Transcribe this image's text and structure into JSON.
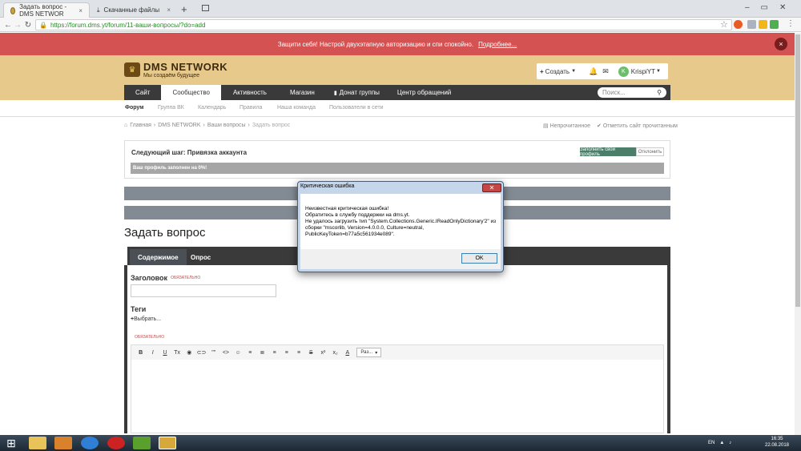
{
  "browser": {
    "tabs": [
      {
        "label": "Задать вопрос - DMS NETWOR",
        "close": "×"
      },
      {
        "label": "Скачанные файлы",
        "close": "×"
      }
    ],
    "new_tab": "+",
    "url": "https://forum.dms.yt/forum/11-ваши-вопросы/?do=add"
  },
  "notice": {
    "text": "Защити себя! Настрой двухэтапную авторизацию и спи спокойно.",
    "link": "Подробнее...",
    "close": "×"
  },
  "header": {
    "logo_title": "DMS NETWORK",
    "logo_sub": "Мы создаём будущее",
    "create_label": "Создать",
    "user_initial": "K",
    "username": "KrispiYT"
  },
  "nav": {
    "tabs": [
      "Сайт",
      "Сообщество",
      "Активность",
      "Магазин",
      "Донат группы",
      "Центр обращений"
    ],
    "search_placeholder": "Поиск..."
  },
  "subnav": [
    "Форум",
    "Группа ВК",
    "Календарь",
    "Правила",
    "Наша команда",
    "Пользователи в сети"
  ],
  "breadcrumb": [
    "Главная",
    "DMS NETWORK",
    "Ваши вопросы",
    "Задать вопрос"
  ],
  "breadcrumb_right": [
    "Непрочитанное",
    "Отметить сайт прочитанным"
  ],
  "next_step": {
    "title": "Следующий шаг: Привязка аккаунта",
    "primary": "Заполнить свой профиль",
    "secondary": "Отклонить",
    "progress_text": "Ваш профиль заполнен на 0%!"
  },
  "page_title": "Задать вопрос",
  "form": {
    "tabs": [
      "Содержимое",
      "Опрос"
    ],
    "title_label": "Заголовок",
    "required": "ОБЯЗАТЕЛЬНО",
    "tags_label": "Теги",
    "tags_select": "Выбрать...",
    "content_required": "ОБЯЗАТЕЛЬНО",
    "font_size": "Раз..."
  },
  "editor_tools": [
    "B",
    "I",
    "U",
    "Tx",
    "◉",
    "⊂⊃",
    "\"\"",
    "<>",
    "☺",
    "≡",
    "≣",
    "≡",
    "≡",
    "≡",
    "S",
    "x²",
    "x₂",
    "A"
  ],
  "dialog": {
    "title": "Критическая ошибка",
    "close": "✕",
    "lines": [
      "Неизвестная критическая ошибка!",
      "Обратитесь в службу поддержки на dms.yt.",
      "Не удалось загрузить тип \"System.Collections.Generic.IReadOnlyDictionary'2\" из сборки \"mscorlib, Version=4.0.0.0, Culture=neutral, PublicKeyToken=b77a5c561934e089\"."
    ],
    "ok": "OK"
  },
  "taskbar": {
    "lang": "EN",
    "time": "16:35",
    "date": "22.08.2018"
  }
}
